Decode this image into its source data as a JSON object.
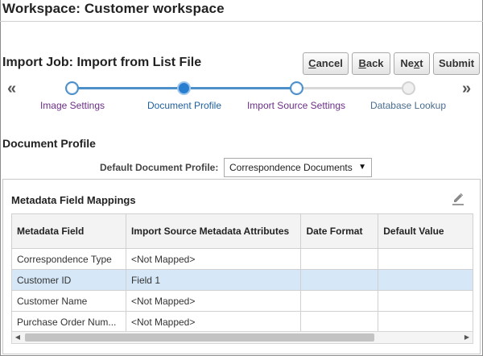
{
  "workspace": {
    "title": "Workspace: Customer workspace"
  },
  "job": {
    "title": "Import Job: Import from List File"
  },
  "buttons": {
    "cancel": {
      "mnemonic": "C",
      "rest": "ancel"
    },
    "back": {
      "mnemonic": "B",
      "rest": "ack"
    },
    "next": {
      "pre": "Ne",
      "mnemonic": "x",
      "rest": "t"
    },
    "submit": {
      "label": "Submit"
    }
  },
  "train": {
    "prev_glyph": "«",
    "next_glyph": "»",
    "stops": [
      {
        "label": "Image Settings",
        "state": "visited"
      },
      {
        "label": "Document Profile",
        "state": "current"
      },
      {
        "label": "Import Source Settings",
        "state": "visited"
      },
      {
        "label": "Database Lookup",
        "state": "unvisited"
      }
    ]
  },
  "document_profile": {
    "section_title": "Document Profile",
    "default_label": "Default Document Profile:",
    "selected": "Correspondence Documents"
  },
  "mappings": {
    "title": "Metadata Field Mappings",
    "columns": [
      "Metadata Field",
      "Import Source Metadata Attributes",
      "Date Format",
      "Default Value"
    ],
    "rows": [
      {
        "field": "Correspondence Type",
        "attribute": "<Not Mapped>",
        "date_format": "",
        "default_value": "",
        "selected": false
      },
      {
        "field": "Customer ID",
        "attribute": "Field 1",
        "date_format": "",
        "default_value": "",
        "selected": true
      },
      {
        "field": "Customer Name",
        "attribute": "<Not Mapped>",
        "date_format": "",
        "default_value": "",
        "selected": false
      },
      {
        "field": "Purchase Order Num...",
        "attribute": "<Not Mapped>",
        "date_format": "",
        "default_value": "",
        "selected": false
      }
    ]
  },
  "icons": {
    "edit": "pencil-edit-icon",
    "caret": "caret-down-icon"
  },
  "colors": {
    "accent": "#2a7ed0",
    "selected_row": "#d6e8f8",
    "visited_label": "#6a2f86"
  }
}
